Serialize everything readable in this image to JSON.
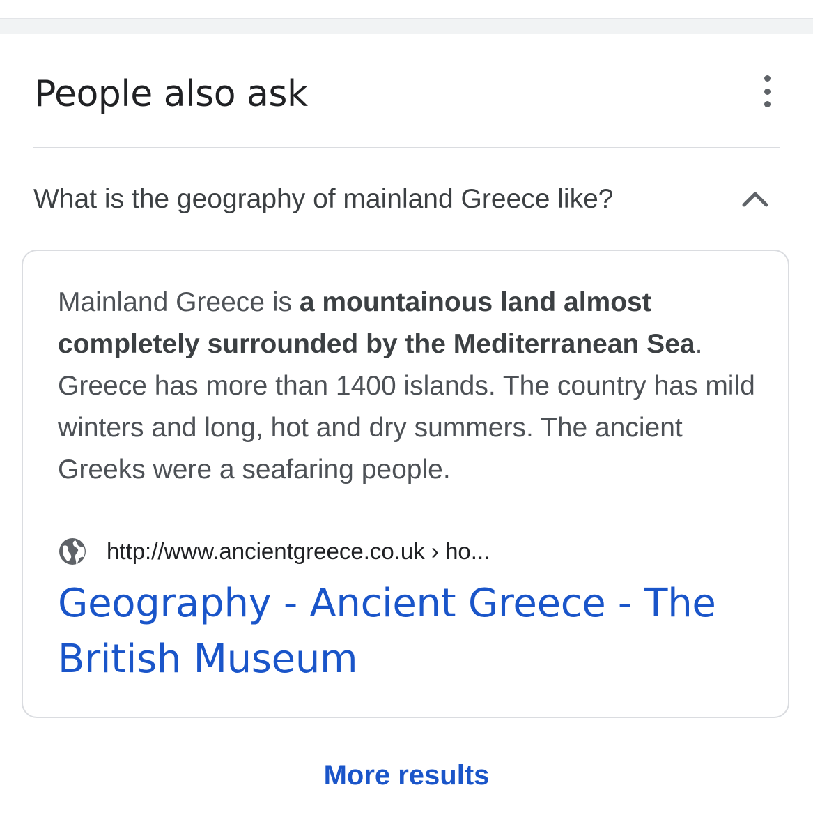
{
  "paa": {
    "title": "People also ask",
    "menu_icon": "more-vert-icon",
    "question": "What is the geography of mainland Greece like?",
    "question_expanded": true,
    "answer": {
      "before_bold": "Mainland Greece is ",
      "bold": "a mountainous land almost completely surrounded by the Mediterranean Sea",
      "after_bold": ". Greece has more than 1400 islands. The country has mild winters and long, hot and dry summers. The ancient Greeks were a seafaring people."
    },
    "source": {
      "icon": "globe-icon",
      "url": "http://www.ancientgreece.co.uk › ho..."
    },
    "result_title": "Geography - Ancient Greece - The British Museum",
    "more_results": "More results"
  },
  "colors": {
    "link_blue": "#1a55c9",
    "text": "#202124",
    "answer_text": "#4d5156",
    "divider": "#dadce0",
    "top_band": "#f1f3f4"
  }
}
